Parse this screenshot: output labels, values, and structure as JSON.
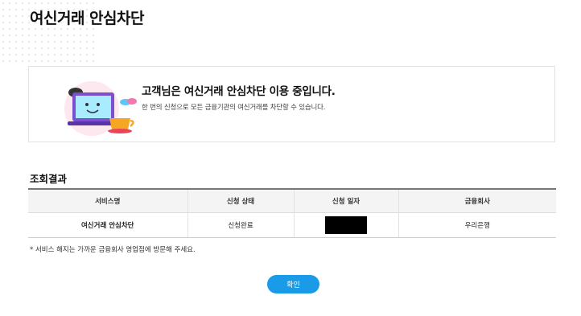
{
  "page": {
    "title": "여신거래 안심차단"
  },
  "info": {
    "heading": "고객님은 여신거래 안심차단 이용 중입니다.",
    "description": "한 번의 신청으로 모든 금융기관의 여신거래를 차단할 수 있습니다."
  },
  "results": {
    "title": "조회결과",
    "columns": [
      "서비스명",
      "신청 상태",
      "신청 일자",
      "금융회사"
    ],
    "rows": [
      {
        "service": "여신거래 안심차단",
        "status": "신청완료",
        "date": "",
        "company": "우리은행"
      }
    ]
  },
  "note": "* 서비스 해지는 가까운 금융회사 영업점에 방문해 주세요.",
  "buttons": {
    "confirm": "확인"
  },
  "colors": {
    "accent": "#1a9be8",
    "header_bg": "#f4f4f4"
  }
}
